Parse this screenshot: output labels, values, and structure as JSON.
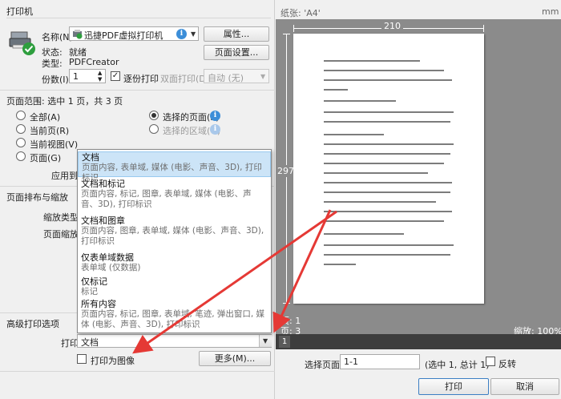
{
  "print_section": {
    "title": "打印机",
    "name_label": "名称(N):",
    "printer_name": "迅捷PDF虚拟打印机",
    "properties_button": "属性...",
    "status_label": "状态:",
    "status_value": "就绪",
    "type_label": "类型:",
    "type_value": "PDFCreator",
    "page_setup_button": "页面设置...",
    "copies_label": "份数(I):",
    "copies_value": "1",
    "collate_label": "逐份打印",
    "duplex_label": "双面打印(D):",
    "duplex_value": "自动 (无)"
  },
  "page_range": {
    "title": "页面范围: 选中 1 页，共 3 页",
    "options": {
      "all": "全部(A)",
      "current_page": "当前页(R)",
      "current_view": "当前视图(V)",
      "pages": "页面(G)",
      "selected_pages": "选择的页面(S)",
      "selected_area": "选择的区域(G)"
    },
    "apply_label": "应用到"
  },
  "layout": {
    "title": "页面排布与缩放",
    "scale_type_label": "缩放类型:",
    "page_scale_label": "页面缩放:"
  },
  "advanced": {
    "title": "高级打印选项",
    "print_label": "打印",
    "print_value": "文档",
    "print_as_image_label": "打印为图像",
    "more_button": "更多(M)..."
  },
  "dropdown": {
    "items": [
      {
        "title": "文档",
        "desc": "页面内容, 表单域, 媒体 (电影、声音、3D), 打印标识"
      },
      {
        "title": "文档和标记",
        "desc": "页面内容, 标记, 图章, 表单域, 媒体 (电影、声音、3D), 打印标识"
      },
      {
        "title": "文档和图章",
        "desc": "页面内容, 图章, 表单域, 媒体 (电影、声音、3D), 打印标识"
      },
      {
        "title": "仅表单域数据",
        "desc": "表单域 (仅数据)"
      },
      {
        "title": "仅标记",
        "desc": "标记"
      },
      {
        "title": "所有内容",
        "desc": "页面内容, 标记, 图章, 表单域, 笔迹, 弹出窗口, 媒体 (电影、声音、3D), 打印标识"
      }
    ]
  },
  "preview": {
    "paper_label": "纸张: 'A4'",
    "unit": "mm",
    "width_value": "210",
    "height_value": "297",
    "page_info_a": "页: 1",
    "page_info_b": "页: 3",
    "zoom": "缩放: 100%",
    "strip_page": "1"
  },
  "bottom": {
    "select_pages_label": "选择页面:",
    "select_pages_value": "1-1",
    "select_info": "(选中 1, 总计 1)",
    "reverse_label": "反转",
    "print_button": "打印",
    "cancel_button": "取消"
  },
  "colors": {
    "arrow": "#e53935",
    "selection": "#cce4f7",
    "info": "#3c8ed8",
    "status_ok": "#2e9e3e"
  }
}
